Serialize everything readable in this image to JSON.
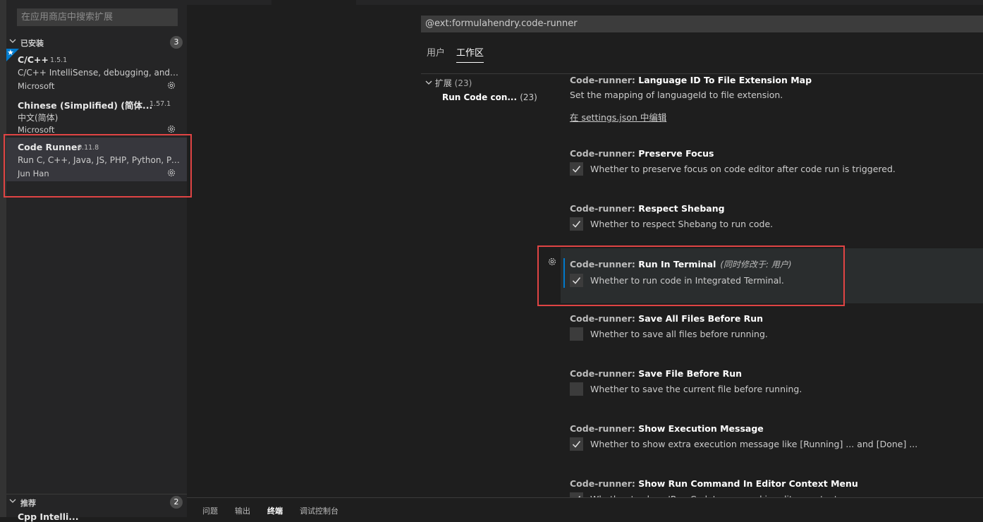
{
  "sidebar": {
    "search_placeholder": "在应用商店中搜索扩展",
    "installed": {
      "title": "已安装",
      "count": "3"
    },
    "recommended": {
      "title": "推荐",
      "count": "2",
      "partial_item": "Cpp Intelli..."
    },
    "extensions": [
      {
        "name": "C/C++",
        "version": "1.5.1",
        "description": "C/C++ IntelliSense, debugging, and c...",
        "publisher": "Microsoft"
      },
      {
        "name": "Chinese (Simplified) (简体...",
        "version": "1.57.1",
        "description": "中文(简体)",
        "publisher": "Microsoft"
      },
      {
        "name": "Code Runner",
        "version": "0.11.8",
        "description": "Run C, C++, Java, JS, PHP, Python, Perl...",
        "publisher": "Jun Han"
      }
    ]
  },
  "settings": {
    "filter_value": "@ext:formulahendry.code-runner",
    "tabs": [
      {
        "label": "用户"
      },
      {
        "label": "工作区"
      }
    ],
    "toc": {
      "group": "扩展",
      "group_count": "(23)",
      "item": "Run Code con...",
      "item_count": "(23)"
    },
    "items": [
      {
        "category": "Code-runner: ",
        "name": "Language ID To File Extension Map",
        "description": "Set the mapping of languageId to file extension.",
        "link": "在 settings.json 中编辑"
      },
      {
        "category": "Code-runner: ",
        "name": "Preserve Focus",
        "description": "Whether to preserve focus on code editor after code run is triggered.",
        "checked": true
      },
      {
        "category": "Code-runner: ",
        "name": "Respect Shebang",
        "description": "Whether to respect Shebang to run code.",
        "checked": true
      },
      {
        "category": "Code-runner: ",
        "name": "Run In Terminal",
        "modified_note": "(同时修改于: 用户)",
        "description": "Whether to run code in Integrated Terminal.",
        "checked": true
      },
      {
        "category": "Code-runner: ",
        "name": "Save All Files Before Run",
        "description": "Whether to save all files before running.",
        "checked": false
      },
      {
        "category": "Code-runner: ",
        "name": "Save File Before Run",
        "description": "Whether to save the current file before running.",
        "checked": false
      },
      {
        "category": "Code-runner: ",
        "name": "Show Execution Message",
        "description": "Whether to show extra execution message like [Running] ... and [Done] ...",
        "checked": true
      },
      {
        "category": "Code-runner: ",
        "name": "Show Run Command In Editor Context Menu",
        "description": "Whether to show 'Run Code' command in editor context menu.",
        "checked": true
      }
    ]
  },
  "panel": {
    "tabs": [
      {
        "label": "问题"
      },
      {
        "label": "输出"
      },
      {
        "label": "终端"
      },
      {
        "label": "调试控制台"
      }
    ]
  },
  "colors": {
    "accent": "#007acc",
    "highlight_border": "#e04444"
  }
}
